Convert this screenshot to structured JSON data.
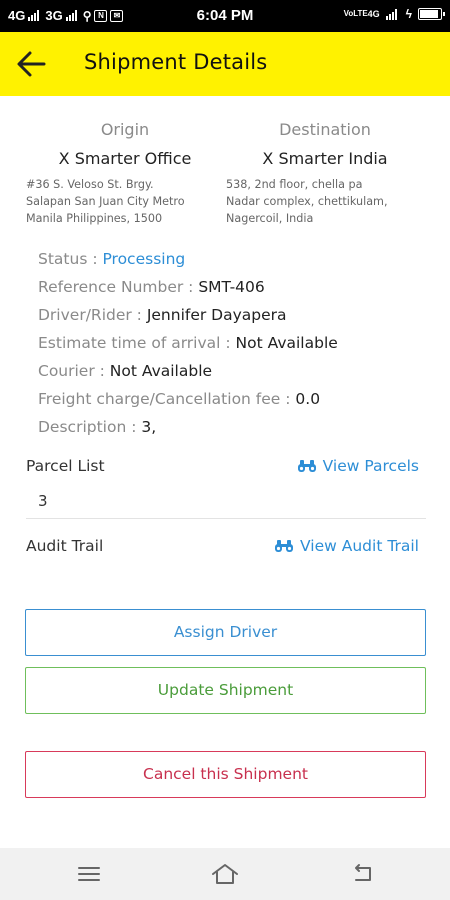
{
  "status_bar": {
    "network_1": "4G",
    "network_2": "3G",
    "time": "6:04 PM",
    "volte": "VoLTE",
    "right_net": "4G"
  },
  "header": {
    "title": "Shipment Details",
    "accent_color": "#fff200"
  },
  "origin": {
    "label": "Origin",
    "name": "X Smarter Office",
    "address": "#36 S. Veloso St. Brgy.\nSalapan San Juan City Metro\nManila Philippines, 1500"
  },
  "destination": {
    "label": "Destination",
    "name": "X Smarter India",
    "address": "538, 2nd floor, chella pa\nNadar complex, chettikulam,\nNagercoil, India"
  },
  "details": {
    "status_label": "Status : ",
    "status_value": "Processing",
    "reference_label": "Reference Number : ",
    "reference_value": "SMT-406",
    "driver_label": "Driver/Rider : ",
    "driver_value": "Jennifer Dayapera",
    "eta_label": "Estimate time of arrival : ",
    "eta_value": "Not Available",
    "courier_label": "Courier : ",
    "courier_value": "Not Available",
    "freight_label": "Freight charge/Cancellation fee : ",
    "freight_value": "0.0",
    "description_label": "Description : ",
    "description_value": "3,"
  },
  "parcel_list": {
    "label": "Parcel List",
    "link": "View Parcels",
    "count": "3"
  },
  "audit_trail": {
    "label": "Audit Trail",
    "link": "View Audit Trail"
  },
  "actions": {
    "assign": "Assign Driver",
    "update": "Update Shipment",
    "cancel": "Cancel this Shipment"
  },
  "icons": {
    "back": "arrow-left-icon",
    "binoculars": "binoculars-icon",
    "nav_menu": "menu-icon",
    "nav_home": "home-icon",
    "nav_back": "back-icon"
  },
  "colors": {
    "link_blue": "#2d8ed6",
    "update_green": "#4a9c3a",
    "cancel_red": "#c8304e"
  }
}
